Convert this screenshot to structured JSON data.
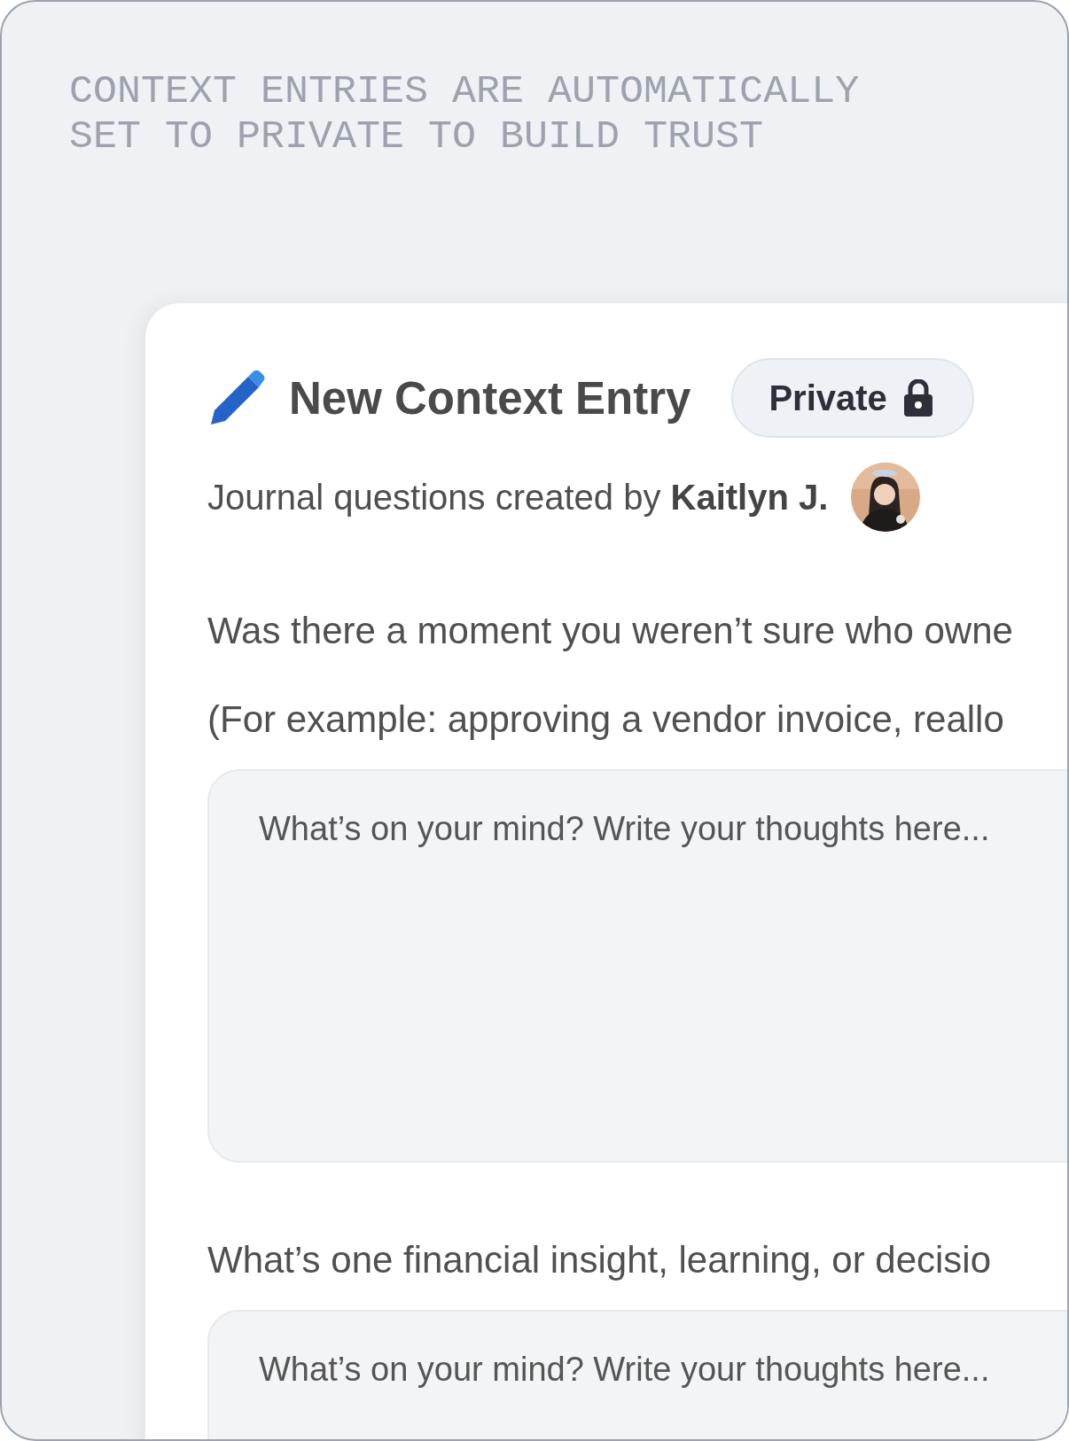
{
  "caption": "CONTEXT ENTRIES ARE AUTOMATICALLY SET TO PRIVATE TO BUILD TRUST",
  "entry": {
    "title": "New Context Entry",
    "privacy": {
      "label": "Private",
      "locked": true
    }
  },
  "byline": "Journal questions created by **Kaitlyn J.**",
  "questions": [
    {
      "prompt": "Was there a moment you weren’t sure who owne",
      "note": "(For example: approving a vendor invoice, reallo",
      "placeholder": "What’s on your mind? Write your thoughts here..."
    },
    {
      "prompt": "What’s one financial insight, learning, or decisio",
      "placeholder": "What’s on your mind? Write your thoughts here..."
    }
  ]
}
